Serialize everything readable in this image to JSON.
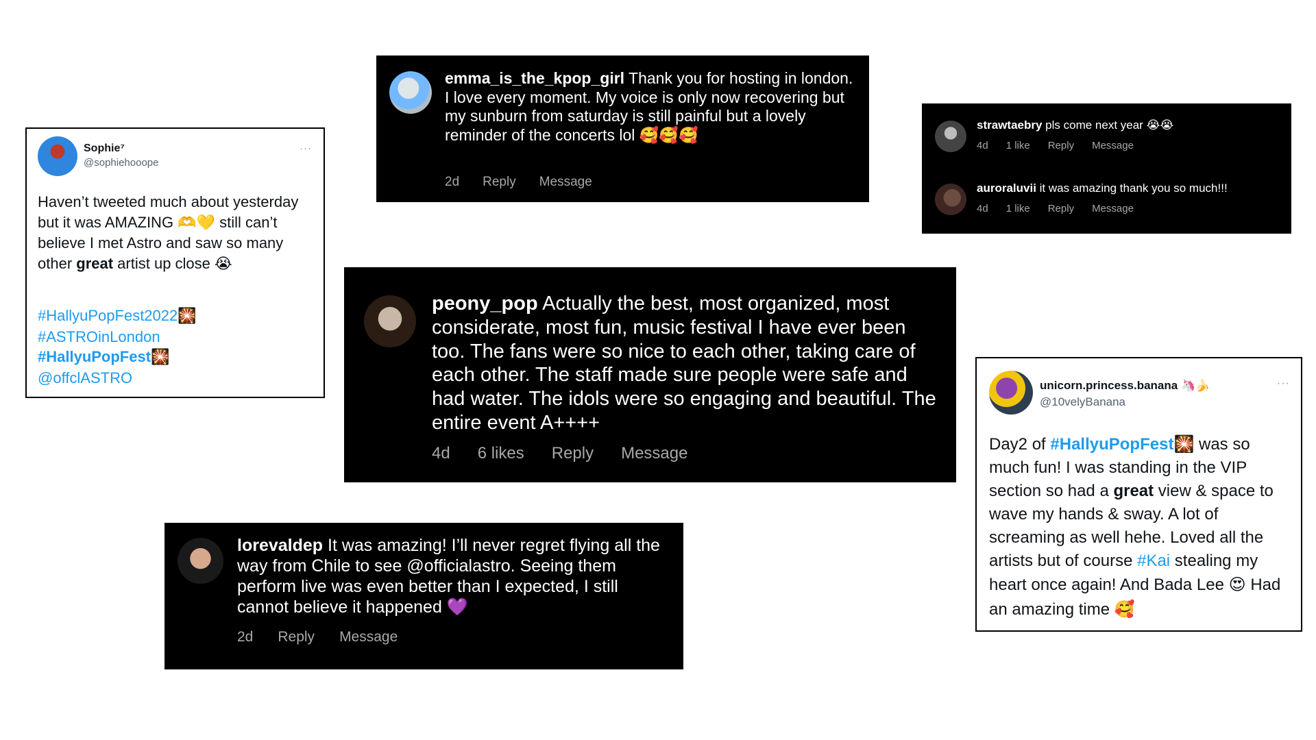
{
  "sophie": {
    "name": "Sophie⁷",
    "handle": "@sophiehooope",
    "dots": "···",
    "text_1": "Haven’t tweeted much about yesterday but it was AMAZING ",
    "emoji_1": "🫶💛",
    "text_2": " still can’t believe I met Astro and saw so many other ",
    "bold_1": "great",
    "text_3": " artist up close ",
    "emoji_2": "😭",
    "tag_1": "#HallyuPopFest2022",
    "tag_1_emoji": "🎇",
    "tag_2": "#ASTROinLondon",
    "tag_3": "#HallyuPopFest",
    "tag_3_emoji": "🎇",
    "mention": "@offclASTRO"
  },
  "emma": {
    "user": "emma_is_the_kpop_girl",
    "text": " Thank you for hosting in london. I love every moment. My voice is only now recovering but my sunburn from saturday is still painful but a lovely reminder of the concerts lol ",
    "emoji": "🥰🥰🥰",
    "time": "2d",
    "reply": "Reply",
    "message": "Message"
  },
  "straw": {
    "user": "strawtaebry",
    "text": " pls come next year ",
    "emoji": "😭😭",
    "time": "4d",
    "likes": "1 like",
    "reply": "Reply",
    "message": "Message"
  },
  "aurora": {
    "user": "auroraluvii",
    "text": " it was amazing thank you so much!!!",
    "time": "4d",
    "likes": "1 like",
    "reply": "Reply",
    "message": "Message"
  },
  "peony": {
    "user": "peony_pop",
    "text": " Actually the best, most organized, most considerate, most fun, music festival I have ever been too. The fans were so nice to each other, taking care of each other. The staff made sure people were safe and had water. The idols were so engaging and beautiful. The entire event A++++",
    "time": "4d",
    "likes": "6 likes",
    "reply": "Reply",
    "message": "Message"
  },
  "lore": {
    "user": "lorevaldep",
    "text": " It was amazing! I’ll never regret flying all the way from Chile to see @officialastro. Seeing them perform live was even better than I expected, I still cannot believe it happened ",
    "emoji": "💜",
    "time": "2d",
    "reply": "Reply",
    "message": "Message"
  },
  "unicorn": {
    "name": "unicorn.princess.banana ",
    "name_emoji": "🦄🍌",
    "handle": "@10velyBanana",
    "dots": "···",
    "t1": "Day2 of ",
    "tag_1": "#HallyuPopFest",
    "tag_1_emoji": "🎇",
    "t2": " was so much fun! I was standing in the VIP section so had a ",
    "bold_1": "great",
    "t3": " view & space to wave my hands & sway. A lot of screaming as well hehe. Loved all the artists but of course ",
    "tag_2": "#Kai",
    "t4": " stealing my heart once again! And Bada Lee ",
    "emoji_1": "😍",
    "t5": " Had an amazing time ",
    "emoji_2": "🥰"
  }
}
